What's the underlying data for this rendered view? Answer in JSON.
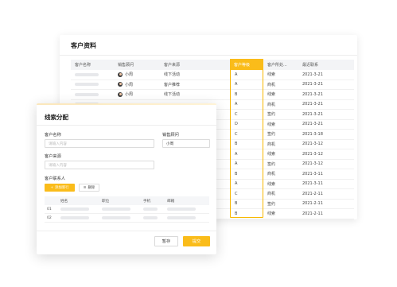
{
  "customer_panel": {
    "title": "客户资料",
    "columns": {
      "name": "客户名称",
      "sales": "销售顾问",
      "source": "客户来源",
      "level": "客户等级",
      "status": "客户所处...",
      "recent": "最近联系"
    },
    "rows": [
      {
        "sales": "小周",
        "source": "线下活动",
        "level": "A",
        "status": "线索",
        "date": "2021-3-21"
      },
      {
        "sales": "小周",
        "source": "客户推荐",
        "level": "A",
        "status": "商机",
        "date": "2021-3-21"
      },
      {
        "sales": "小周",
        "source": "线下活动",
        "level": "B",
        "status": "线索",
        "date": "2021-3-21"
      },
      {
        "sales": "",
        "source": "",
        "level": "A",
        "status": "商机",
        "date": "2021-3-21"
      },
      {
        "sales": "",
        "source": "",
        "level": "C",
        "status": "签约",
        "date": "2021-3-21"
      },
      {
        "sales": "",
        "source": "",
        "level": "D",
        "status": "线索",
        "date": "2021-3-21"
      },
      {
        "sales": "",
        "source": "",
        "level": "C",
        "status": "签约",
        "date": "2021-3-18"
      },
      {
        "sales": "",
        "source": "",
        "level": "B",
        "status": "商机",
        "date": "2021-3-12"
      },
      {
        "sales": "",
        "source": "",
        "level": "A",
        "status": "线索",
        "date": "2021-3-12"
      },
      {
        "sales": "",
        "source": "",
        "level": "A",
        "status": "签约",
        "date": "2021-3-12"
      },
      {
        "sales": "",
        "source": "",
        "level": "B",
        "status": "商机",
        "date": "2021-3-11"
      },
      {
        "sales": "",
        "source": "",
        "level": "A",
        "status": "线索",
        "date": "2021-3-11"
      },
      {
        "sales": "",
        "source": "",
        "level": "C",
        "status": "商机",
        "date": "2021-2-11"
      },
      {
        "sales": "",
        "source": "",
        "level": "B",
        "status": "签约",
        "date": "2021-2-11"
      },
      {
        "sales": "",
        "source": "",
        "level": "B",
        "status": "线索",
        "date": "2021-2-11"
      }
    ]
  },
  "lead_form": {
    "title": "线索分配",
    "customer_name_label": "客户名称",
    "customer_name_placeholder": "请输入内容",
    "sales_label": "销售顾问",
    "sales_value": "小周",
    "source_label": "客户来源",
    "source_placeholder": "请输入内容",
    "contacts_label": "客户联系人",
    "add_row_label": "添加新行",
    "delete_label": "删除",
    "contact_columns": {
      "name": "姓名",
      "title": "职位",
      "phone": "手机",
      "email": "邮箱"
    },
    "contact_rows": [
      {
        "index": "01"
      },
      {
        "index": "02"
      }
    ],
    "save_label": "暂存",
    "submit_label": "提交"
  },
  "colors": {
    "accent": "#fabc1a",
    "placeholder_bar": "#e7e8eb"
  }
}
